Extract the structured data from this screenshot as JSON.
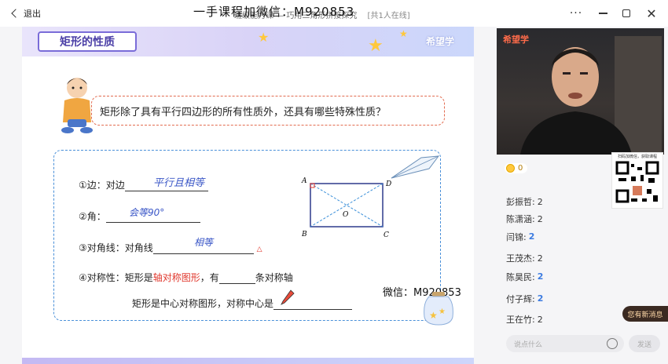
{
  "titlebar": {
    "back_label": "退出",
    "watermark": "一手课程加微信：M920853",
    "title": "班级能力课 — 巧用三角形拼接探究",
    "online": "[共1人在线]",
    "more": "···",
    "close": "✕"
  },
  "slide": {
    "header_title": "矩形的性质",
    "brand": "希望学",
    "question": "矩形除了具有平行四边形的所有性质外，还具有哪些特殊性质？",
    "props": {
      "side": "①边：对边",
      "side_hand": "平行且相等",
      "angle": "②角：",
      "angle_hand": "会等90°",
      "diagonal": "③对角线：对角线",
      "diagonal_hand": "相等",
      "symmetry_prefix": "④对称性：矩形是",
      "symmetry_red": "轴对称图形",
      "symmetry_mid": "，有",
      "symmetry_suffix": "条对称轴",
      "center_prefix": "矩形是中心对称图形，对称中心是"
    },
    "diagram": {
      "A": "A",
      "B": "B",
      "C": "C",
      "D": "D",
      "O": "O"
    },
    "wechat": "微信：M920853"
  },
  "sidebar": {
    "video_brand": "希望学",
    "coins": "0",
    "qr_caption": "扫码加微信，获取课程",
    "ranking": [
      {
        "name": "彭振哲:",
        "value": "2",
        "badge": ""
      },
      {
        "name": "陈潇涵:",
        "value": "2",
        "badge": ""
      },
      {
        "name": "闫锦:",
        "value": "",
        "badge": "2"
      },
      {
        "name": "王茂杰:",
        "value": "2",
        "badge": ""
      },
      {
        "name": "陈昊民:",
        "value": "",
        "badge": "2"
      },
      {
        "name": "付子辉:",
        "value": "",
        "badge": "2"
      },
      {
        "name": "王在竹:",
        "value": "2",
        "badge": ""
      }
    ],
    "new_msg": "您有新消息",
    "input_placeholder": "说点什么",
    "send_label": "发送"
  }
}
